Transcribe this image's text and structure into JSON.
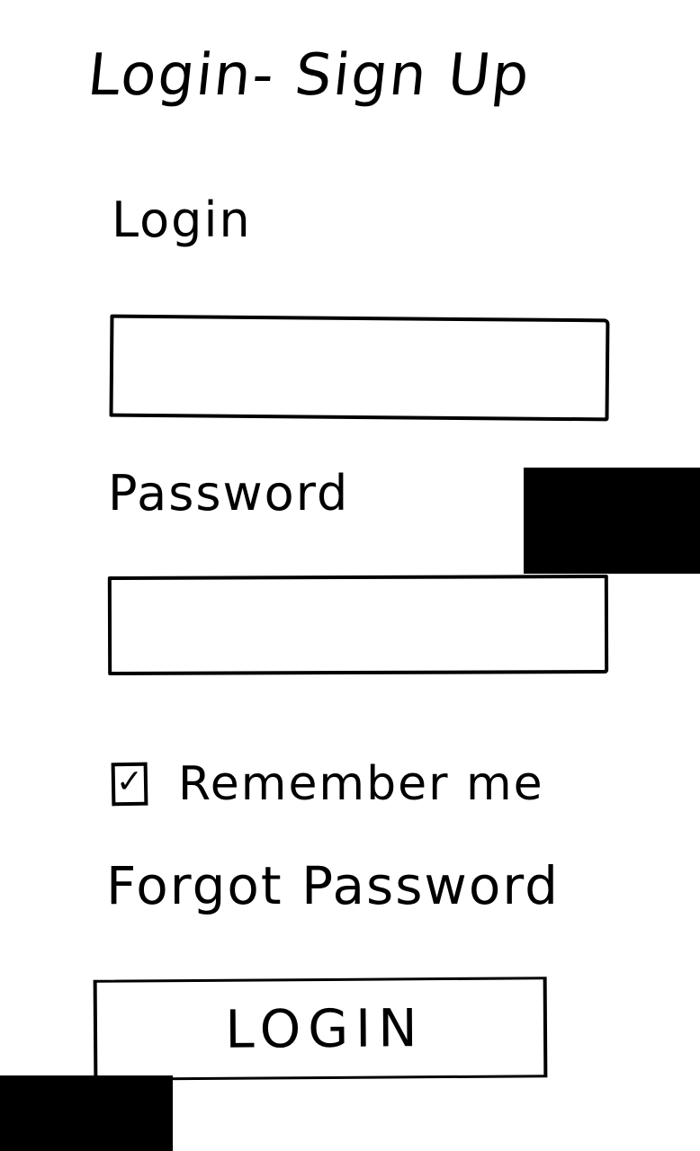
{
  "page": {
    "title": "Login- Sign Up"
  },
  "form": {
    "login_label": "Login",
    "login_value": "",
    "password_label": "Password",
    "password_value": "",
    "remember": {
      "checked": true,
      "check_glyph": "✓",
      "label": "Remember me"
    },
    "forgot_password_label": "Forgot Password",
    "submit_label": "LOGIN"
  },
  "colors": {
    "ink": "#000000",
    "paper": "#ffffff"
  },
  "icons": {
    "checkbox": "checkmark-icon"
  }
}
